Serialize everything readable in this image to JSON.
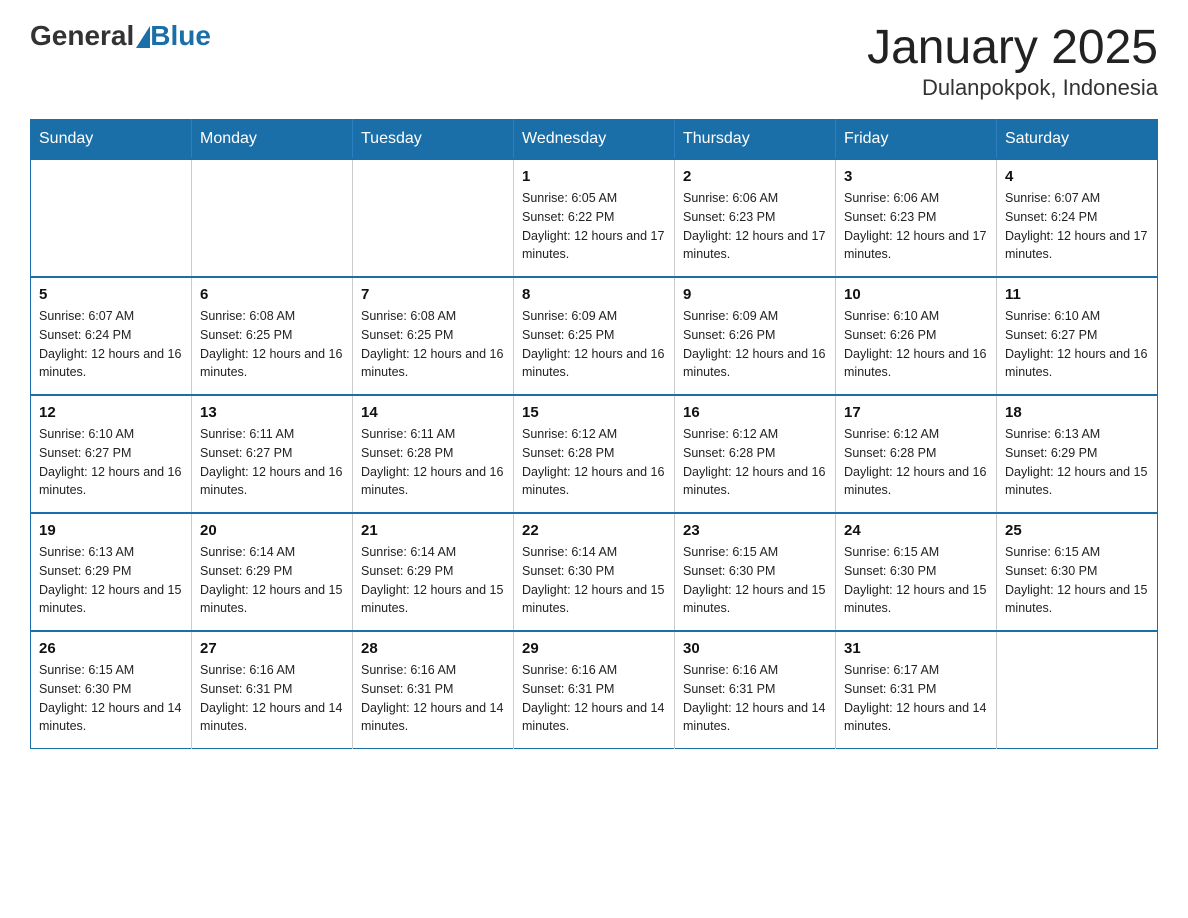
{
  "header": {
    "logo_general": "General",
    "logo_blue": "Blue",
    "title": "January 2025",
    "subtitle": "Dulanpokpok, Indonesia"
  },
  "days_of_week": [
    "Sunday",
    "Monday",
    "Tuesday",
    "Wednesday",
    "Thursday",
    "Friday",
    "Saturday"
  ],
  "weeks": [
    {
      "days": [
        {
          "num": "",
          "info": ""
        },
        {
          "num": "",
          "info": ""
        },
        {
          "num": "",
          "info": ""
        },
        {
          "num": "1",
          "info": "Sunrise: 6:05 AM\nSunset: 6:22 PM\nDaylight: 12 hours and 17 minutes."
        },
        {
          "num": "2",
          "info": "Sunrise: 6:06 AM\nSunset: 6:23 PM\nDaylight: 12 hours and 17 minutes."
        },
        {
          "num": "3",
          "info": "Sunrise: 6:06 AM\nSunset: 6:23 PM\nDaylight: 12 hours and 17 minutes."
        },
        {
          "num": "4",
          "info": "Sunrise: 6:07 AM\nSunset: 6:24 PM\nDaylight: 12 hours and 17 minutes."
        }
      ]
    },
    {
      "days": [
        {
          "num": "5",
          "info": "Sunrise: 6:07 AM\nSunset: 6:24 PM\nDaylight: 12 hours and 16 minutes."
        },
        {
          "num": "6",
          "info": "Sunrise: 6:08 AM\nSunset: 6:25 PM\nDaylight: 12 hours and 16 minutes."
        },
        {
          "num": "7",
          "info": "Sunrise: 6:08 AM\nSunset: 6:25 PM\nDaylight: 12 hours and 16 minutes."
        },
        {
          "num": "8",
          "info": "Sunrise: 6:09 AM\nSunset: 6:25 PM\nDaylight: 12 hours and 16 minutes."
        },
        {
          "num": "9",
          "info": "Sunrise: 6:09 AM\nSunset: 6:26 PM\nDaylight: 12 hours and 16 minutes."
        },
        {
          "num": "10",
          "info": "Sunrise: 6:10 AM\nSunset: 6:26 PM\nDaylight: 12 hours and 16 minutes."
        },
        {
          "num": "11",
          "info": "Sunrise: 6:10 AM\nSunset: 6:27 PM\nDaylight: 12 hours and 16 minutes."
        }
      ]
    },
    {
      "days": [
        {
          "num": "12",
          "info": "Sunrise: 6:10 AM\nSunset: 6:27 PM\nDaylight: 12 hours and 16 minutes."
        },
        {
          "num": "13",
          "info": "Sunrise: 6:11 AM\nSunset: 6:27 PM\nDaylight: 12 hours and 16 minutes."
        },
        {
          "num": "14",
          "info": "Sunrise: 6:11 AM\nSunset: 6:28 PM\nDaylight: 12 hours and 16 minutes."
        },
        {
          "num": "15",
          "info": "Sunrise: 6:12 AM\nSunset: 6:28 PM\nDaylight: 12 hours and 16 minutes."
        },
        {
          "num": "16",
          "info": "Sunrise: 6:12 AM\nSunset: 6:28 PM\nDaylight: 12 hours and 16 minutes."
        },
        {
          "num": "17",
          "info": "Sunrise: 6:12 AM\nSunset: 6:28 PM\nDaylight: 12 hours and 16 minutes."
        },
        {
          "num": "18",
          "info": "Sunrise: 6:13 AM\nSunset: 6:29 PM\nDaylight: 12 hours and 15 minutes."
        }
      ]
    },
    {
      "days": [
        {
          "num": "19",
          "info": "Sunrise: 6:13 AM\nSunset: 6:29 PM\nDaylight: 12 hours and 15 minutes."
        },
        {
          "num": "20",
          "info": "Sunrise: 6:14 AM\nSunset: 6:29 PM\nDaylight: 12 hours and 15 minutes."
        },
        {
          "num": "21",
          "info": "Sunrise: 6:14 AM\nSunset: 6:29 PM\nDaylight: 12 hours and 15 minutes."
        },
        {
          "num": "22",
          "info": "Sunrise: 6:14 AM\nSunset: 6:30 PM\nDaylight: 12 hours and 15 minutes."
        },
        {
          "num": "23",
          "info": "Sunrise: 6:15 AM\nSunset: 6:30 PM\nDaylight: 12 hours and 15 minutes."
        },
        {
          "num": "24",
          "info": "Sunrise: 6:15 AM\nSunset: 6:30 PM\nDaylight: 12 hours and 15 minutes."
        },
        {
          "num": "25",
          "info": "Sunrise: 6:15 AM\nSunset: 6:30 PM\nDaylight: 12 hours and 15 minutes."
        }
      ]
    },
    {
      "days": [
        {
          "num": "26",
          "info": "Sunrise: 6:15 AM\nSunset: 6:30 PM\nDaylight: 12 hours and 14 minutes."
        },
        {
          "num": "27",
          "info": "Sunrise: 6:16 AM\nSunset: 6:31 PM\nDaylight: 12 hours and 14 minutes."
        },
        {
          "num": "28",
          "info": "Sunrise: 6:16 AM\nSunset: 6:31 PM\nDaylight: 12 hours and 14 minutes."
        },
        {
          "num": "29",
          "info": "Sunrise: 6:16 AM\nSunset: 6:31 PM\nDaylight: 12 hours and 14 minutes."
        },
        {
          "num": "30",
          "info": "Sunrise: 6:16 AM\nSunset: 6:31 PM\nDaylight: 12 hours and 14 minutes."
        },
        {
          "num": "31",
          "info": "Sunrise: 6:17 AM\nSunset: 6:31 PM\nDaylight: 12 hours and 14 minutes."
        },
        {
          "num": "",
          "info": ""
        }
      ]
    }
  ]
}
